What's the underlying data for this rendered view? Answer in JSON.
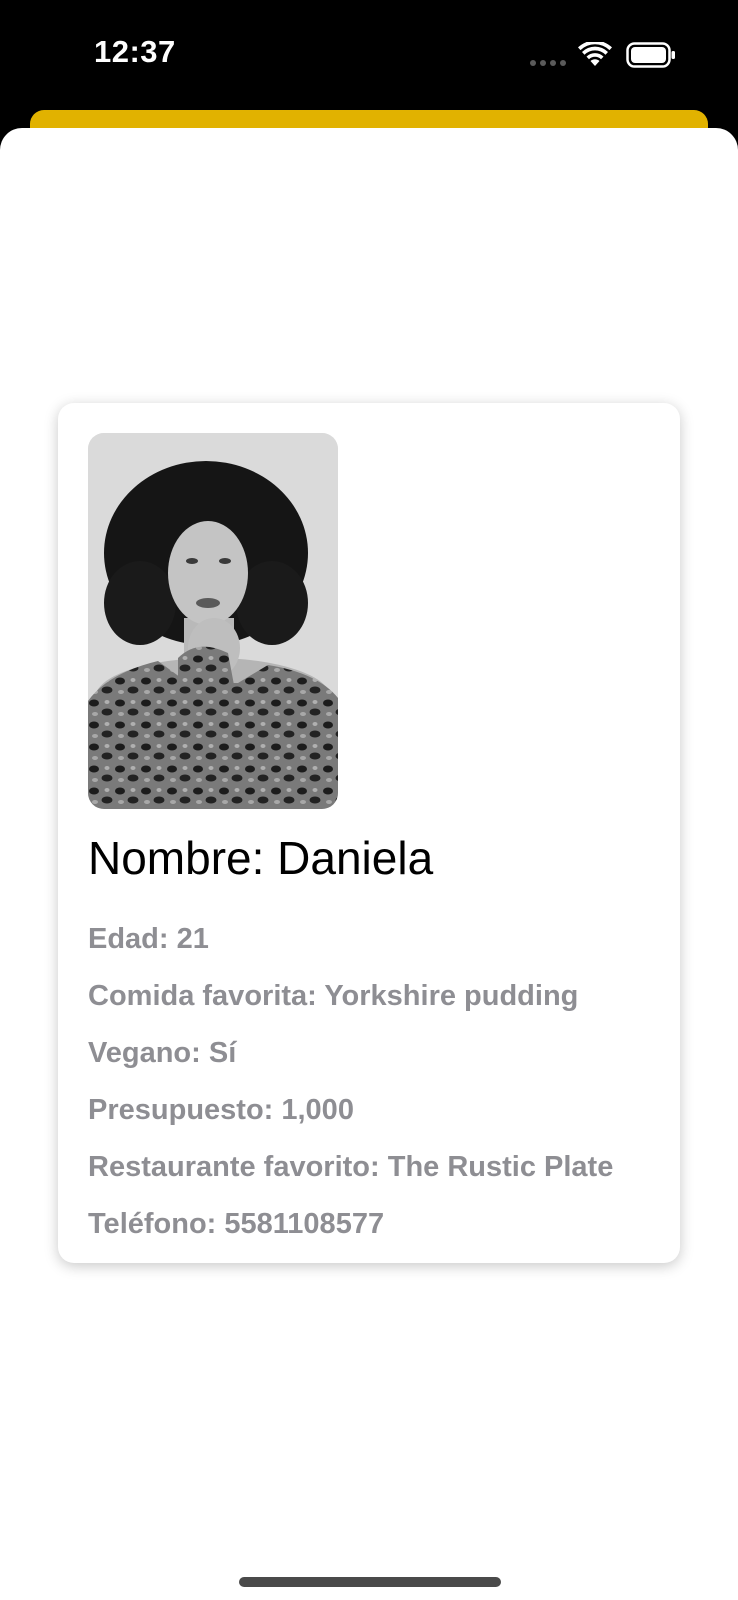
{
  "status_bar": {
    "time": "12:37",
    "wifi_icon": "wifi-icon",
    "battery_icon": "battery-icon",
    "signal_icon": "signal-dots-icon"
  },
  "profile": {
    "name": "Nombre: Daniela",
    "photo_icon": "profile-photo",
    "details": [
      "Edad: 21",
      "Comida favorita: Yorkshire pudding",
      "Vegano: Sí",
      "Presupuesto: 1,000",
      "Restaurante favorito: The Rustic Plate",
      "Teléfono: 5581108577"
    ]
  },
  "colors": {
    "accent_sheet": "#e1b200",
    "detail_text": "#8e8e93",
    "background": "#ffffff"
  }
}
